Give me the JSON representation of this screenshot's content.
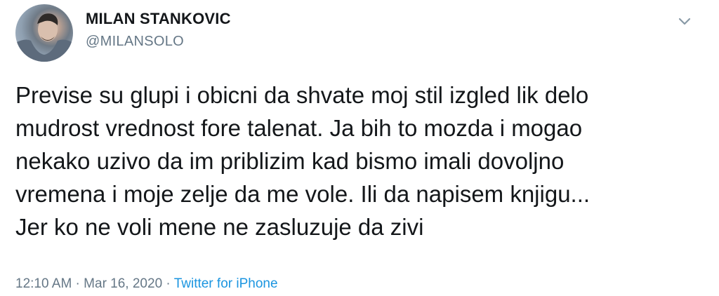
{
  "tweet": {
    "author": {
      "name": "MILAN STANKOVIC",
      "handle": "@MILANSOLO"
    },
    "text": "Previse su glupi i obicni da shvate moj stil izgled lik delo\nmudrost vrednost fore talenat. Ja bih to mozda i mogao\nnekako uzivo da im priblizim kad bismo imali dovoljno\nvremena i moje zelje da me vole. Ili da napisem knjigu...\nJer ko ne voli mene ne zasluzuje da zivi",
    "time": "12:10 AM",
    "separator1": " · ",
    "date": "Mar 16, 2020",
    "separator2": " · ",
    "source": "Twitter for iPhone",
    "menu_icon": "chevron-down-icon"
  }
}
